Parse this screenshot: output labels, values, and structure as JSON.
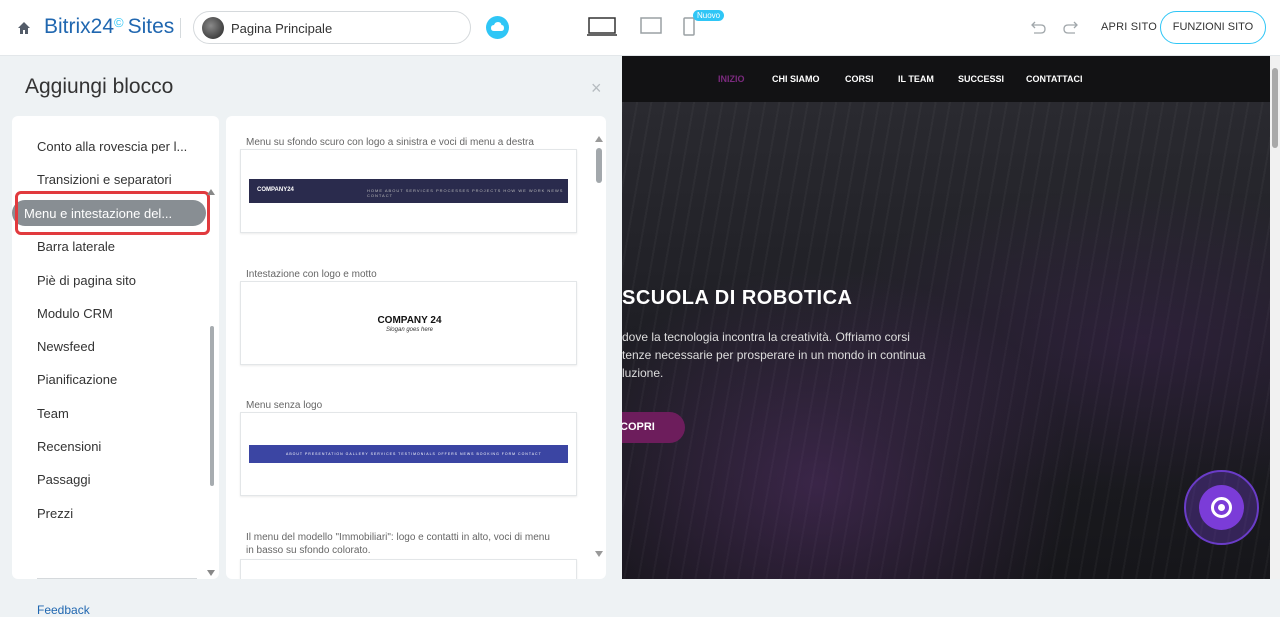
{
  "header": {
    "brand_main": "Bitrix24",
    "brand_clock": "©",
    "brand_sub": "Sites",
    "page_selector": "Pagina Principale",
    "new_badge": "Nuovo",
    "open_site": "APRI SITO",
    "site_functions": "FUNZIONI SITO"
  },
  "panel": {
    "title": "Aggiungi blocco",
    "close": "×",
    "categories": [
      "Conto alla rovescia per l...",
      "Transizioni e separatori",
      "Menu e intestazione del...",
      "Barra laterale",
      "Piè di pagina sito",
      "Modulo CRM",
      "Newsfeed",
      "Pianificazione",
      "Team",
      "Recensioni",
      "Passaggi",
      "Prezzi"
    ],
    "active_category": "Menu e intestazione del...",
    "feedback": "Feedback",
    "blocks": [
      {
        "title": "Menu su sfondo scuro con logo a sinistra e voci di menu a destra",
        "logo": "COMPANY24",
        "items": "HOME  ABOUT  SERVICES  PROCESSES  PROJECTS  HOW WE WORK  NEWS  CONTACT"
      },
      {
        "title": "Intestazione con logo e motto",
        "company": "COMPANY 24",
        "slogan": "Slogan goes here"
      },
      {
        "title": "Menu senza logo",
        "items": "ABOUT  PRESENTATION  GALLERY  SERVICES  TESTIMONIALS  OFFERS  NEWS  BOOKING FORM  CONTACT"
      },
      {
        "title": "Il menu del modello \"Immobiliari\": logo e contatti in alto, voci di menu in basso su sfondo colorato."
      }
    ]
  },
  "preview": {
    "nav": [
      "INIZIO",
      "CHI SIAMO",
      "CORSI",
      "IL TEAM",
      "SUCCESSI",
      "CONTATTACI"
    ],
    "hero_title": "SCUOLA DI ROBOTICA",
    "hero_text": "dove la tecnologia incontra la creatività. Offriamo corsi tenze necessarie per prosperare in un mondo in continua luzione.",
    "hero_button": "COPRI"
  },
  "colors": {
    "brand_light": "#2fc6f6",
    "brand_dark": "#2067b0",
    "highlight": "#e13a3e",
    "active_nav": "#7b2a7e",
    "hero_button": "#6d1d5c"
  }
}
